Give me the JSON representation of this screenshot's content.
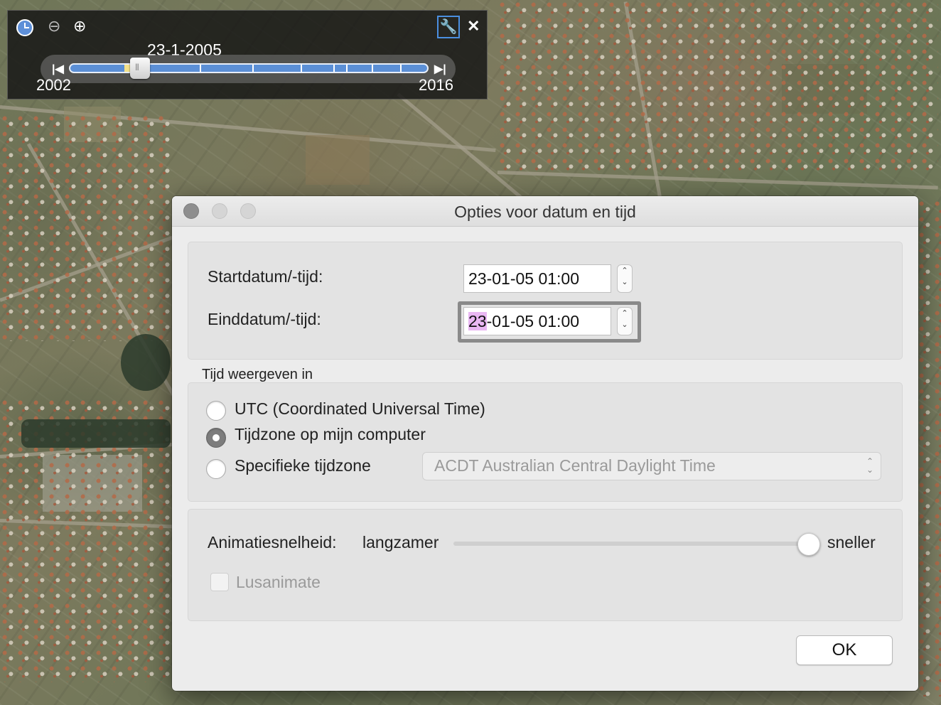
{
  "timeslider": {
    "current_date": "23-1-2005",
    "range_start": "2002",
    "range_end": "2016",
    "icons": [
      "clock-icon",
      "zoom-out-icon",
      "zoom-in-icon",
      "wrench-icon",
      "close-icon"
    ]
  },
  "dialog": {
    "title": "Opties voor datum en tijd",
    "start_label": "Startdatum/-tijd:",
    "start_value": "23-01-05 01:00",
    "end_label": "Einddatum/-tijd:",
    "end_value_highlight": "23",
    "end_value_rest": "-01-05 01:00",
    "timezone_section": "Tijd weergeven in",
    "radio_utc": "UTC (Coordinated Universal Time)",
    "radio_local": "Tijdzone op mijn computer",
    "radio_specific": "Specifieke tijdzone",
    "selected_radio": "Tijdzone op mijn computer",
    "timezone_select": "ACDT Australian Central Daylight Time",
    "speed_label": "Animatiesnelheid:",
    "speed_slow": "langzamer",
    "speed_fast": "sneller",
    "speed_level": 1.0,
    "loop_label": "Lusanimate",
    "loop_checked": false,
    "ok_label": "OK"
  }
}
